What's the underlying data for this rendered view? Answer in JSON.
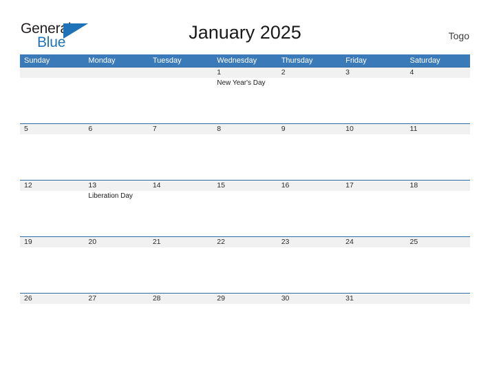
{
  "brand": {
    "name_part1": "General",
    "name_part2": "Blue",
    "triangle_color": "#1d72b8",
    "logo_icon": "flag-triangle-icon"
  },
  "header": {
    "title": "January 2025",
    "country": "Togo"
  },
  "theme": {
    "header_blue": "#3b7ab8",
    "rule_blue": "#2e6da4",
    "date_band": "#f1f1f1",
    "text": "#1a1a1a"
  },
  "calendar": {
    "month": "January",
    "year": "2025",
    "weekdays": [
      "Sunday",
      "Monday",
      "Tuesday",
      "Wednesday",
      "Thursday",
      "Friday",
      "Saturday"
    ],
    "weeks": [
      {
        "dates": [
          "",
          "",
          "",
          "1",
          "2",
          "3",
          "4"
        ],
        "events": [
          "",
          "",
          "",
          "New Year's Day",
          "",
          "",
          ""
        ]
      },
      {
        "dates": [
          "5",
          "6",
          "7",
          "8",
          "9",
          "10",
          "11"
        ],
        "events": [
          "",
          "",
          "",
          "",
          "",
          "",
          ""
        ]
      },
      {
        "dates": [
          "12",
          "13",
          "14",
          "15",
          "16",
          "17",
          "18"
        ],
        "events": [
          "",
          "Liberation Day",
          "",
          "",
          "",
          "",
          ""
        ]
      },
      {
        "dates": [
          "19",
          "20",
          "21",
          "22",
          "23",
          "24",
          "25"
        ],
        "events": [
          "",
          "",
          "",
          "",
          "",
          "",
          ""
        ]
      },
      {
        "dates": [
          "26",
          "27",
          "28",
          "29",
          "30",
          "31",
          ""
        ],
        "events": [
          "",
          "",
          "",
          "",
          "",
          "",
          ""
        ]
      }
    ]
  }
}
